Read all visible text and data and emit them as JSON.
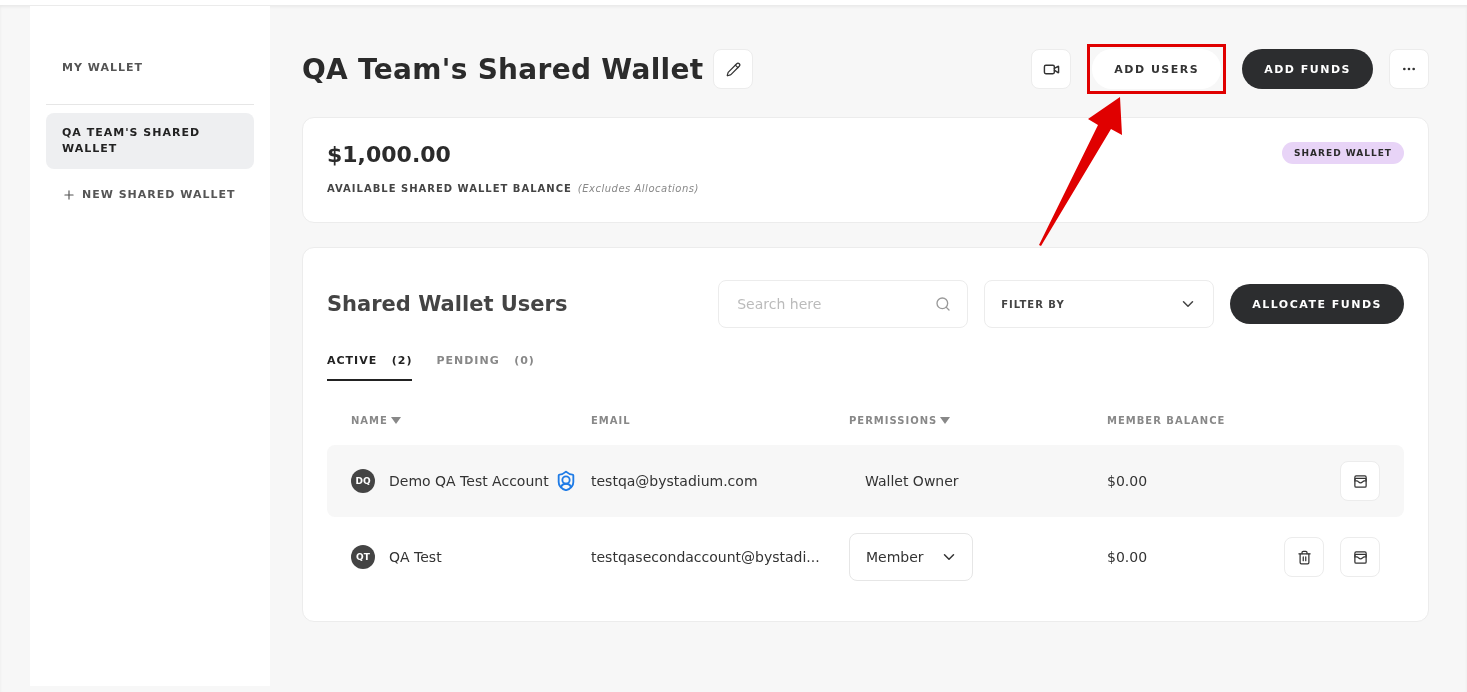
{
  "sidebar": {
    "items": [
      {
        "label": "MY WALLET",
        "kind": "link",
        "selected": false
      },
      {
        "label": "QA TEAM'S SHARED WALLET",
        "kind": "link",
        "selected": true
      },
      {
        "label": "NEW SHARED WALLET",
        "kind": "add",
        "selected": false
      }
    ]
  },
  "header": {
    "title": "QA Team's Shared Wallet",
    "add_users": "ADD USERS",
    "add_users_highlighted": true,
    "add_funds": "ADD FUNDS"
  },
  "balance": {
    "amount": "$1,000.00",
    "label": "AVAILABLE SHARED WALLET BALANCE",
    "note": "(Excludes Allocations)",
    "badge": "SHARED WALLET"
  },
  "users": {
    "title": "Shared Wallet Users",
    "search": {
      "placeholder": "Search here"
    },
    "filter": "FILTER BY",
    "allocate": "ALLOCATE FUNDS",
    "tabs": [
      {
        "label": "ACTIVE",
        "count": "(2)",
        "selected": true
      },
      {
        "label": "PENDING",
        "count": "(0)",
        "selected": false
      }
    ],
    "columns": [
      {
        "label": "NAME",
        "sortable": true
      },
      {
        "label": "EMAIL",
        "sortable": false
      },
      {
        "label": "PERMISSIONS",
        "sortable": true
      },
      {
        "label": "MEMBER BALANCE",
        "sortable": false
      }
    ],
    "rows": [
      {
        "initials": "DQ",
        "name": "Demo QA Test Account",
        "owner_badge": true,
        "email": "testqa@bystadium.com",
        "permission": {
          "kind": "text",
          "value": "Wallet Owner"
        },
        "balance": "$0.00",
        "highlighted": true,
        "can_delete": false
      },
      {
        "initials": "QT",
        "name": "QA Test",
        "owner_badge": false,
        "email": "testqasecondaccount@bystadi...",
        "permission": {
          "kind": "select",
          "value": "Member"
        },
        "balance": "$0.00",
        "highlighted": false,
        "can_delete": true
      }
    ]
  }
}
